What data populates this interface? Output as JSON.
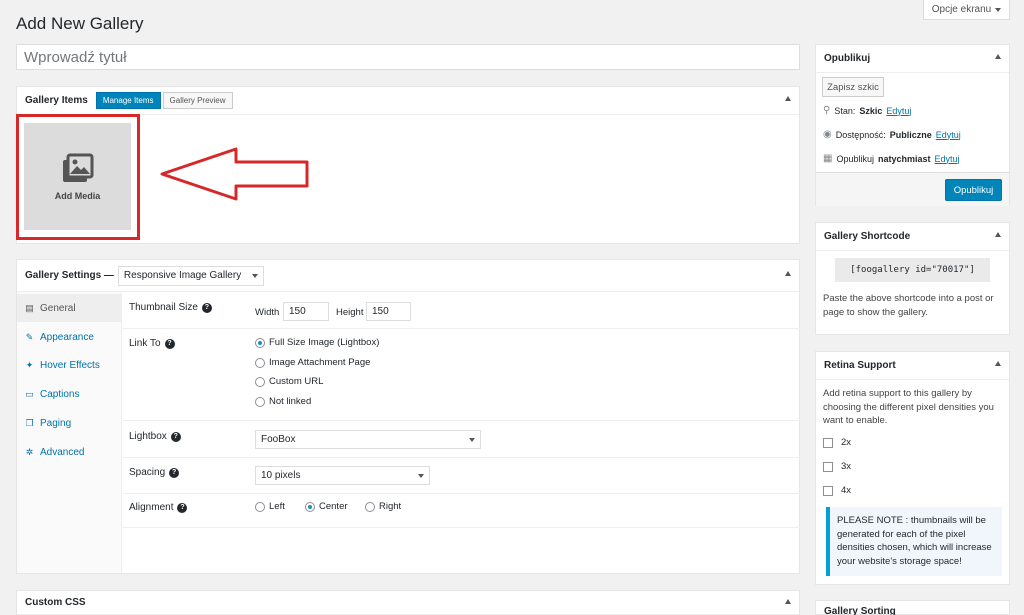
{
  "header": {
    "screen_options": "Opcje ekranu",
    "page_title": "Add New Gallery"
  },
  "title_input": {
    "placeholder": "Wprowadź tytuł"
  },
  "gallery_items": {
    "heading": "Gallery Items",
    "tabs": [
      {
        "label": "Manage Items",
        "active": true
      },
      {
        "label": "Gallery Preview",
        "active": false
      }
    ],
    "add_media": "Add Media"
  },
  "gallery_settings": {
    "heading": "Gallery Settings —",
    "template": "Responsive Image Gallery",
    "nav": [
      {
        "label": "General",
        "icon": "sliders-icon",
        "active": true
      },
      {
        "label": "Appearance",
        "icon": "paintbrush-icon"
      },
      {
        "label": "Hover Effects",
        "icon": "wrench-icon"
      },
      {
        "label": "Captions",
        "icon": "comment-icon"
      },
      {
        "label": "Paging",
        "icon": "pages-icon"
      },
      {
        "label": "Advanced",
        "icon": "gear-icon"
      }
    ],
    "thumb": {
      "label": "Thumbnail Size",
      "width_label": "Width",
      "width": "150",
      "height_label": "Height",
      "height": "150"
    },
    "link_to": {
      "label": "Link To",
      "options": [
        "Full Size Image (Lightbox)",
        "Image Attachment Page",
        "Custom URL",
        "Not linked"
      ],
      "selected_index": 0
    },
    "lightbox": {
      "label": "Lightbox",
      "value": "FooBox"
    },
    "spacing": {
      "label": "Spacing",
      "value": "10 pixels"
    },
    "alignment": {
      "label": "Alignment",
      "options": [
        "Left",
        "Center",
        "Right"
      ],
      "selected_index": 1
    }
  },
  "custom_css": {
    "heading": "Custom CSS"
  },
  "publish": {
    "heading": "Opublikuj",
    "save_draft": "Zapisz szkic",
    "status_label": "Stan:",
    "status_value": "Szkic",
    "visibility_label": "Dostępność:",
    "visibility_value": "Publiczne",
    "publish_label": "Opublikuj",
    "publish_value": "natychmiast",
    "edit": "Edytuj",
    "publish_button": "Opublikuj"
  },
  "shortcode": {
    "heading": "Gallery Shortcode",
    "code": "[foogallery id=\"70017\"]",
    "help": "Paste the above shortcode into a post or page to show the gallery."
  },
  "retina": {
    "heading": "Retina Support",
    "desc": "Add retina support to this gallery by choosing the different pixel densities you want to enable.",
    "options": [
      "2x",
      "3x",
      "4x"
    ],
    "note": "PLEASE NOTE : thumbnails will be generated for each of the pixel densities chosen, which will increase your website's storage space!"
  },
  "sorting": {
    "heading": "Gallery Sorting"
  },
  "colors": {
    "accent": "#0085ba",
    "annotation": "#d62828"
  }
}
